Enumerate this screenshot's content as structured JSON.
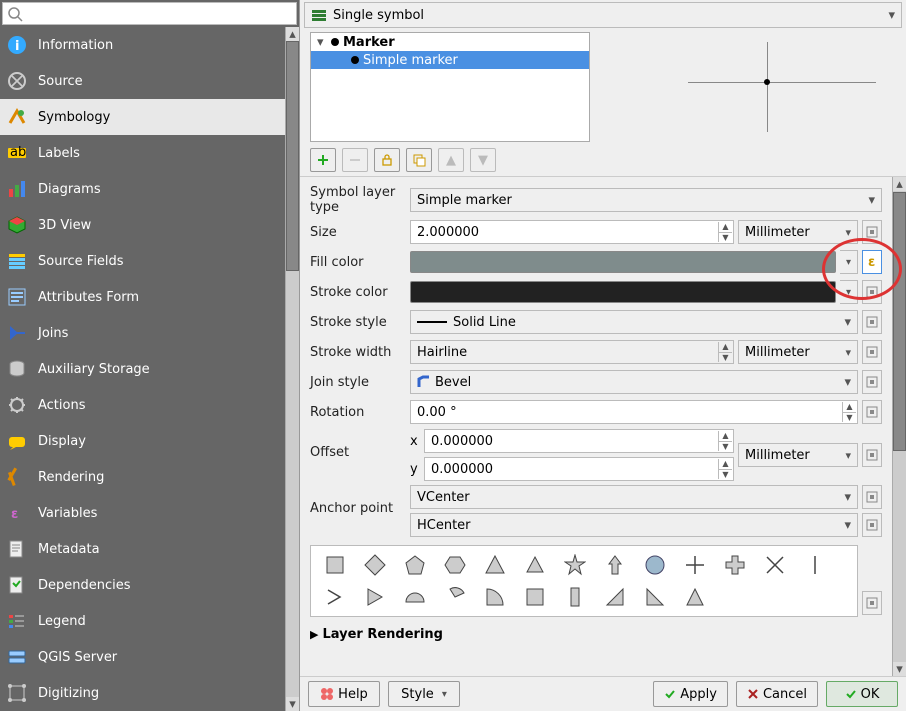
{
  "search": {
    "placeholder": ""
  },
  "sidebar": {
    "items": [
      {
        "label": "Information",
        "icon": "info"
      },
      {
        "label": "Source",
        "icon": "source"
      },
      {
        "label": "Symbology",
        "icon": "symbology",
        "selected": true
      },
      {
        "label": "Labels",
        "icon": "labels"
      },
      {
        "label": "Diagrams",
        "icon": "diagrams"
      },
      {
        "label": "3D View",
        "icon": "3dview"
      },
      {
        "label": "Source Fields",
        "icon": "sourcefields"
      },
      {
        "label": "Attributes Form",
        "icon": "attrform"
      },
      {
        "label": "Joins",
        "icon": "joins"
      },
      {
        "label": "Auxiliary Storage",
        "icon": "auxstorage"
      },
      {
        "label": "Actions",
        "icon": "actions"
      },
      {
        "label": "Display",
        "icon": "display"
      },
      {
        "label": "Rendering",
        "icon": "rendering"
      },
      {
        "label": "Variables",
        "icon": "variables"
      },
      {
        "label": "Metadata",
        "icon": "metadata"
      },
      {
        "label": "Dependencies",
        "icon": "deps"
      },
      {
        "label": "Legend",
        "icon": "legend"
      },
      {
        "label": "QGIS Server",
        "icon": "server"
      },
      {
        "label": "Digitizing",
        "icon": "digitizing"
      }
    ]
  },
  "renderer_selector": "Single symbol",
  "tree": {
    "root": "Marker",
    "child": "Simple marker"
  },
  "symbol_layer_type": {
    "label": "Symbol layer type",
    "value": "Simple marker"
  },
  "rows": {
    "size": {
      "label": "Size",
      "value": "2.000000",
      "unit": "Millimeter"
    },
    "fill_color": {
      "label": "Fill color",
      "color": "#7f8c8c"
    },
    "stroke_color": {
      "label": "Stroke color",
      "color": "#222222"
    },
    "stroke_style": {
      "label": "Stroke style",
      "value": "Solid Line"
    },
    "stroke_width": {
      "label": "Stroke width",
      "value": "Hairline",
      "unit": "Millimeter"
    },
    "join_style": {
      "label": "Join style",
      "value": "Bevel"
    },
    "rotation": {
      "label": "Rotation",
      "value": "0.00 °"
    },
    "offset": {
      "label": "Offset",
      "x_label": "x",
      "y_label": "y",
      "x": "0.000000",
      "y": "0.000000",
      "unit": "Millimeter"
    },
    "anchor": {
      "label": "Anchor point",
      "v": "VCenter",
      "h": "HCenter"
    }
  },
  "layer_rendering": "Layer Rendering",
  "bottombar": {
    "help": "Help",
    "style": "Style",
    "apply": "Apply",
    "cancel": "Cancel",
    "ok": "OK"
  }
}
